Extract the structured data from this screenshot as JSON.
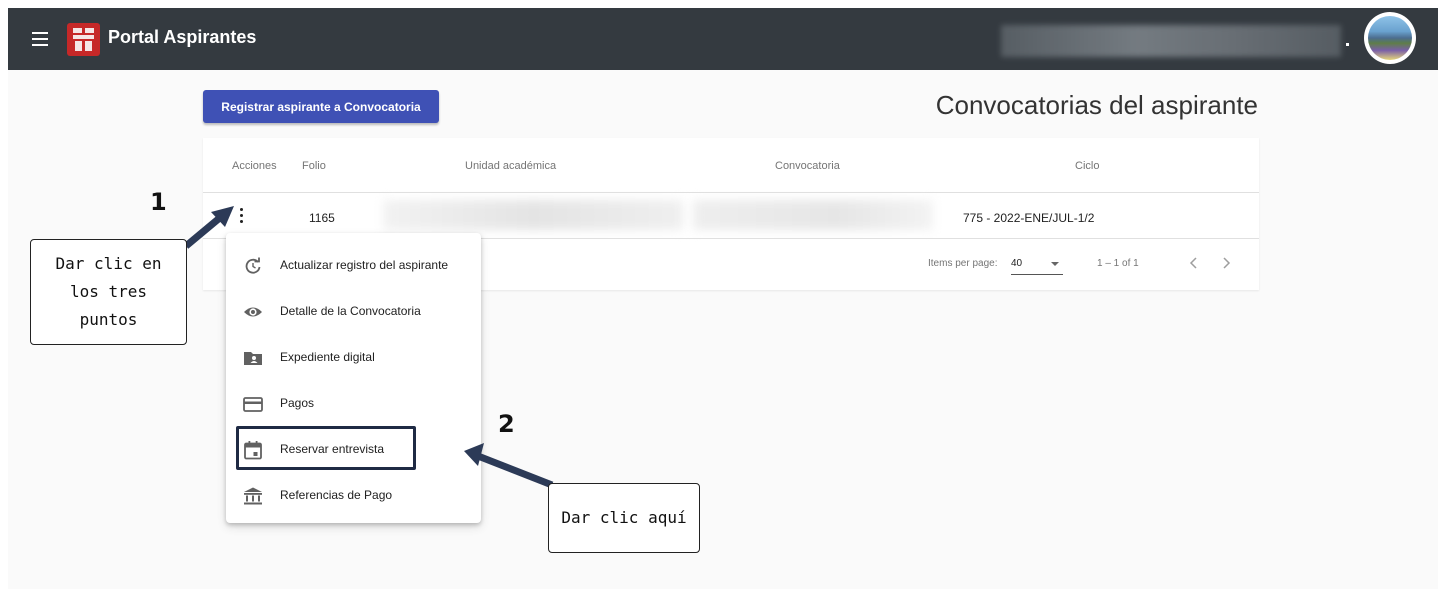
{
  "header": {
    "title": "Portal Aspirantes",
    "user_suffix": "."
  },
  "main": {
    "register_button": "Registrar aspirante a Convocatoria",
    "heading": "Convocatorias del aspirante"
  },
  "table": {
    "columns": [
      "Acciones",
      "Folio",
      "Unidad académica",
      "Convocatoria",
      "Ciclo"
    ],
    "rows": [
      {
        "folio": "1165",
        "unidad": "",
        "convocatoria": "",
        "ciclo": "775 - 2022-ENE/JUL-1/2"
      }
    ],
    "paginator": {
      "items_per_page_label": "Items per page:",
      "page_size": "40",
      "range_label": "1 – 1 of 1"
    }
  },
  "context_menu": {
    "items": [
      {
        "label": "Actualizar registro del aspirante",
        "icon": "refresh-icon"
      },
      {
        "label": "Detalle de la Convocatoria",
        "icon": "eye-icon"
      },
      {
        "label": "Expediente digital",
        "icon": "folder-account-icon"
      },
      {
        "label": "Pagos",
        "icon": "credit-card-icon"
      },
      {
        "label": "Reservar entrevista",
        "icon": "calendar-event-icon"
      },
      {
        "label": "Referencias de Pago",
        "icon": "bank-icon"
      }
    ]
  },
  "annotations": {
    "step1_number": "1",
    "step1_text": "Dar clic en los tres puntos",
    "step2_number": "2",
    "step2_text": "Dar clic aquí"
  },
  "colors": {
    "toolbar": "#343a40",
    "primary_button": "#3f51b5",
    "logo": "#c62828",
    "highlight_border": "#1f2a44",
    "annotation_arrow": "#2c3a57"
  }
}
